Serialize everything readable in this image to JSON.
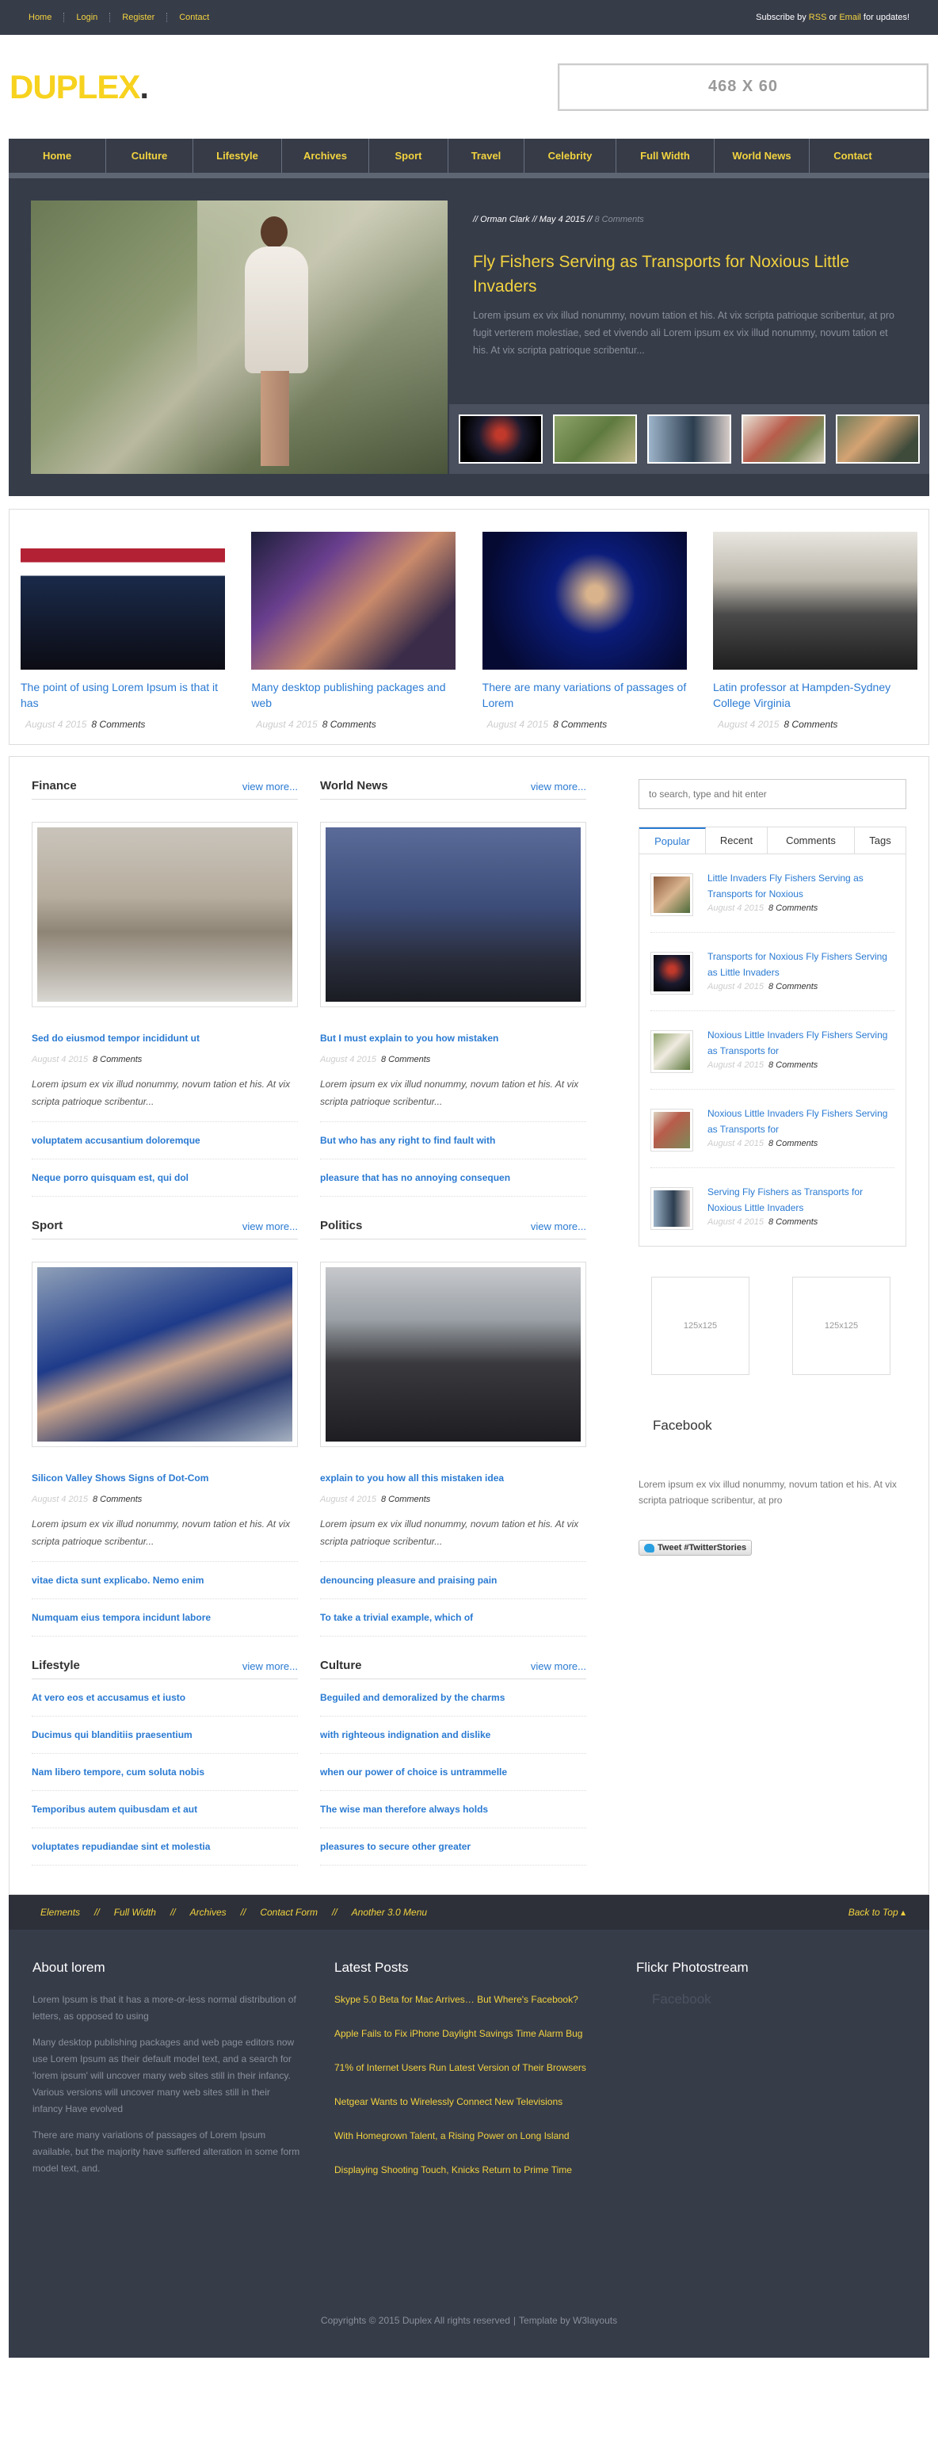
{
  "topbar": {
    "links": [
      "Home",
      "Login",
      "Register",
      "Contact"
    ],
    "subscribe_pre": "Subscribe by ",
    "rss": "RSS",
    "or": " or ",
    "email": "Email",
    "subscribe_post": " for updates!"
  },
  "header": {
    "logo": "DUPLEX",
    "logo_dot": ".",
    "ad": "468 X 60"
  },
  "nav": {
    "items": [
      "Home",
      "Culture",
      "Lifestyle",
      "Archives",
      "Sport",
      "Travel",
      "Celebrity",
      "Full Width",
      "World News",
      "Contact"
    ]
  },
  "hero": {
    "meta": "// Orman Clark // May 4 2015 // ",
    "comments": "8 Comments",
    "title": "Fly Fishers Serving as Transports for Noxious Little Invaders",
    "excerpt": "Lorem ipsum ex vix illud nonummy, novum tation et his. At vix scripta patrioque scribentur, at pro fugit verterem molestiae, sed et vivendo ali Lorem ipsum ex vix illud nonummy, novum tation et his. At vix scripta patrioque scribentur..."
  },
  "featured": [
    {
      "title": "The point of using Lorem Ipsum is that it has",
      "date": "August 4 2015",
      "comments": "8 Comments"
    },
    {
      "title": "Many desktop publishing packages and web",
      "date": "August 4 2015",
      "comments": "8 Comments"
    },
    {
      "title": "There are many variations of passages of Lorem",
      "date": "August 4 2015",
      "comments": "8 Comments"
    },
    {
      "title": "Latin professor at Hampden-Sydney College Virginia",
      "date": "August 4 2015",
      "comments": "8 Comments"
    }
  ],
  "categories": [
    {
      "name": "Finance",
      "view": "view more...",
      "lead": "Sed do eiusmod tempor incididunt ut",
      "date": "August 4 2015",
      "comments": "8 Comments",
      "excerpt": "Lorem ipsum ex vix illud nonummy, novum tation et his. At vix scripta patrioque scribentur...",
      "links": [
        "voluptatem accusantium doloremque",
        "Neque porro quisquam est, qui dol"
      ]
    },
    {
      "name": "World News",
      "view": "view more...",
      "lead": "But I must explain to you how mistaken",
      "date": "August 4 2015",
      "comments": "8 Comments",
      "excerpt": "Lorem ipsum ex vix illud nonummy, novum tation et his. At vix scripta patrioque scribentur...",
      "links": [
        "But who has any right to find fault with",
        "pleasure that has no annoying consequen"
      ]
    },
    {
      "name": "Sport",
      "view": "view more...",
      "lead": "Silicon Valley Shows Signs of Dot-Com",
      "date": "August 4 2015",
      "comments": "8 Comments",
      "excerpt": "Lorem ipsum ex vix illud nonummy, novum tation et his. At vix scripta patrioque scribentur...",
      "links": [
        "vitae dicta sunt explicabo. Nemo enim",
        "Numquam eius tempora incidunt labore"
      ]
    },
    {
      "name": "Politics",
      "view": "view more...",
      "lead": "explain to you how all this mistaken idea",
      "date": "August 4 2015",
      "comments": "8 Comments",
      "excerpt": "Lorem ipsum ex vix illud nonummy, novum tation et his. At vix scripta patrioque scribentur...",
      "links": [
        "denouncing pleasure and praising pain",
        "To take a trivial example, which of"
      ]
    },
    {
      "name": "Lifestyle",
      "view": "view more...",
      "links": [
        "At vero eos et accusamus et iusto",
        "Ducimus qui blanditiis praesentium",
        "Nam libero tempore, cum soluta nobis",
        "Temporibus autem quibusdam et aut",
        "voluptates repudiandae sint et molestia"
      ]
    },
    {
      "name": "Culture",
      "view": "view more...",
      "links": [
        "Beguiled and demoralized by the charms",
        "with righteous indignation and dislike",
        "when our power of choice is untrammelle",
        "The wise man therefore always holds",
        "pleasures to secure other greater"
      ]
    }
  ],
  "sidebar": {
    "search_placeholder": "to search, type and hit enter",
    "tabs": [
      "Popular",
      "Recent",
      "Comments",
      "Tags"
    ],
    "popular": [
      {
        "title": "Little Invaders Fly Fishers Serving as Transports for Noxious",
        "date": "August 4 2015",
        "comments": "8 Comments"
      },
      {
        "title": "Transports for Noxious Fly Fishers Serving as Little Invaders",
        "date": "August 4 2015",
        "comments": "8 Comments"
      },
      {
        "title": "Noxious Little Invaders Fly Fishers Serving as Transports for",
        "date": "August 4 2015",
        "comments": "8 Comments"
      },
      {
        "title": "Noxious Little Invaders Fly Fishers Serving as Transports for",
        "date": "August 4 2015",
        "comments": "8 Comments"
      },
      {
        "title": "Serving Fly Fishers as Transports for Noxious Little Invaders",
        "date": "August 4 2015",
        "comments": "8 Comments"
      }
    ],
    "ads": [
      "125x125",
      "125x125"
    ],
    "facebook_heading": "Facebook",
    "facebook_text": "Lorem ipsum ex vix illud nonummy, novum tation et his. At vix scripta patrioque scribentur, at pro",
    "tweet": "Tweet #TwitterStories"
  },
  "footer_nav": {
    "links": [
      "Elements",
      "Full Width",
      "Archives",
      "Contact Form",
      "Another 3.0 Menu"
    ],
    "sep": "//",
    "back": "Back to Top"
  },
  "footer": {
    "about_title": "About lorem",
    "about_p": [
      "Lorem Ipsum is that it has a more-or-less normal distribution of letters, as opposed to using",
      "Many desktop publishing packages and web page editors now use Lorem Ipsum as their default model text, and a search for 'lorem ipsum' will uncover many web sites still in their infancy. Various versions will uncover many web sites still in their infancy Have evolved",
      "There are many variations of passages of Lorem Ipsum available, but the majority have suffered alteration in some form model text, and."
    ],
    "latest_title": "Latest Posts",
    "latest": [
      "Skype 5.0 Beta for Mac Arrives… But Where's Facebook?",
      "Apple Fails to Fix iPhone Daylight Savings Time Alarm Bug",
      "71% of Internet Users Run Latest Version of Their Browsers",
      "Netgear Wants to Wirelessly Connect New Televisions",
      "With Homegrown Talent, a Rising Power on Long Island",
      "Displaying Shooting Touch, Knicks Return to Prime Time"
    ],
    "flickr_title": "Flickr Photostream",
    "flickr_fb": "Facebook",
    "copyright": "Copyrights © 2015 Duplex All rights reserved",
    "copy_sep": "|",
    "template": "Template by W3layouts"
  }
}
